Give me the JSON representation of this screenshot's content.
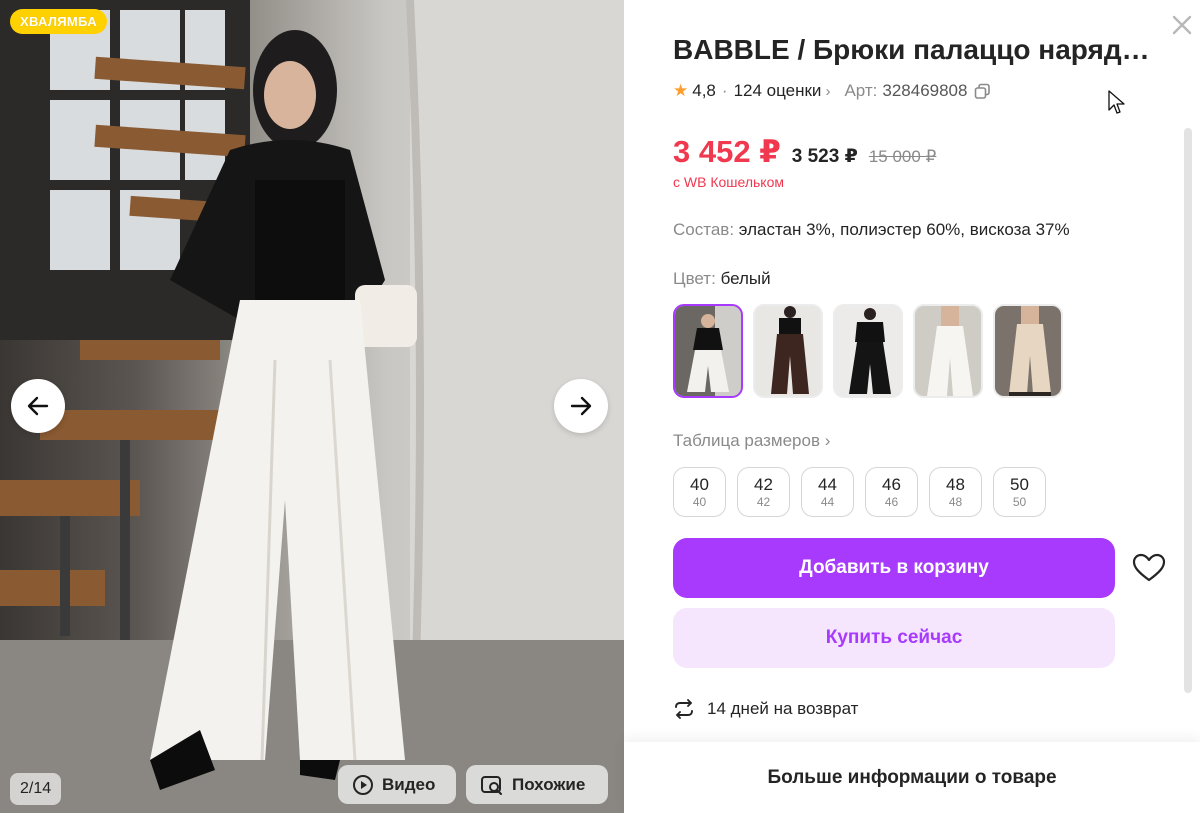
{
  "gallery": {
    "badge": "ХВАЛЯМБА",
    "counter": "2/14",
    "video_label": "Видео",
    "similar_label": "Похожие"
  },
  "product": {
    "title": "BABBLE / Брюки палаццо наряднdfs",
    "rating": "4,8",
    "reviews": "124 оценки",
    "article_label": "Арт:",
    "article_value": "328469808",
    "price_wallet": "3 452 ₽",
    "price_regular": "3 523 ₽",
    "price_original": "15 000 ₽",
    "wallet_note": "с WB Кошельком",
    "composition_label": "Состав:",
    "composition_value": "эластан 3%, полиэстер 60%, вискоза 37%",
    "color_label": "Цвет:",
    "color_value": "белый",
    "color_swatches": [
      "white-on-black-jacket",
      "brown",
      "black",
      "white",
      "beige"
    ],
    "size_table_label": "Таблица размеров",
    "sizes": [
      {
        "ru": "40",
        "intl": "40"
      },
      {
        "ru": "42",
        "intl": "42"
      },
      {
        "ru": "44",
        "intl": "44"
      },
      {
        "ru": "46",
        "intl": "46"
      },
      {
        "ru": "48",
        "intl": "48"
      },
      {
        "ru": "50",
        "intl": "50"
      }
    ],
    "add_to_cart": "Добавить в корзину",
    "buy_now": "Купить сейчас",
    "returns": "14 дней на возврат",
    "more_info": "Больше информации о товаре"
  },
  "colors": {
    "accent": "#a73afd",
    "accent_light": "#f5e6fe",
    "price": "#f0384f",
    "badge": "#ffd100",
    "star": "#ff9e2c"
  }
}
